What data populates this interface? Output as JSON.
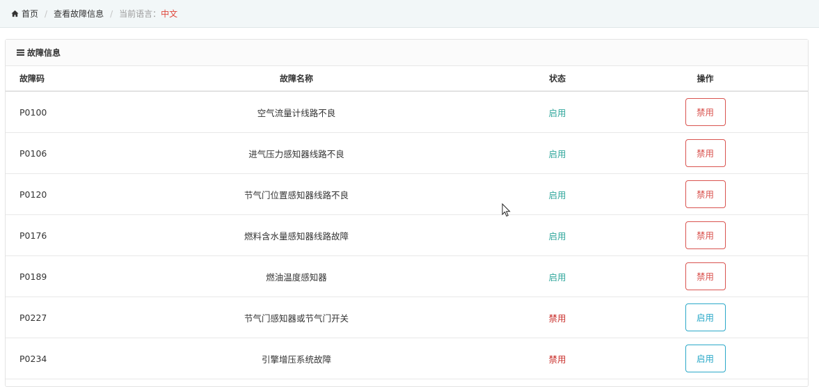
{
  "breadcrumb": {
    "home": "首页",
    "page": "查看故障信息",
    "lang_label": "当前语言：",
    "lang_value": "中文"
  },
  "panel": {
    "title": "故障信息"
  },
  "table": {
    "headers": [
      "故障码",
      "故障名称",
      "状态",
      "操作"
    ],
    "rows": [
      {
        "code": "P0100",
        "name": "空气流量计线路不良",
        "status": "启用",
        "action": "禁用"
      },
      {
        "code": "P0106",
        "name": "进气压力感知器线路不良",
        "status": "启用",
        "action": "禁用"
      },
      {
        "code": "P0120",
        "name": "节气门位置感知器线路不良",
        "status": "启用",
        "action": "禁用"
      },
      {
        "code": "P0176",
        "name": "燃料含水量感知器线路故障",
        "status": "启用",
        "action": "禁用"
      },
      {
        "code": "P0189",
        "name": "燃油温度感知器",
        "status": "启用",
        "action": "禁用"
      },
      {
        "code": "P0227",
        "name": "节气门感知器或节气门开关",
        "status": "禁用",
        "action": "启用"
      },
      {
        "code": "P0234",
        "name": "引擎增压系统故障",
        "status": "禁用",
        "action": "启用"
      }
    ]
  },
  "colors": {
    "status_enabled": "#2fa69b",
    "status_disabled": "#c9302c",
    "btn_disable": "#d9534f",
    "btn_enable": "#2aa8c8"
  }
}
